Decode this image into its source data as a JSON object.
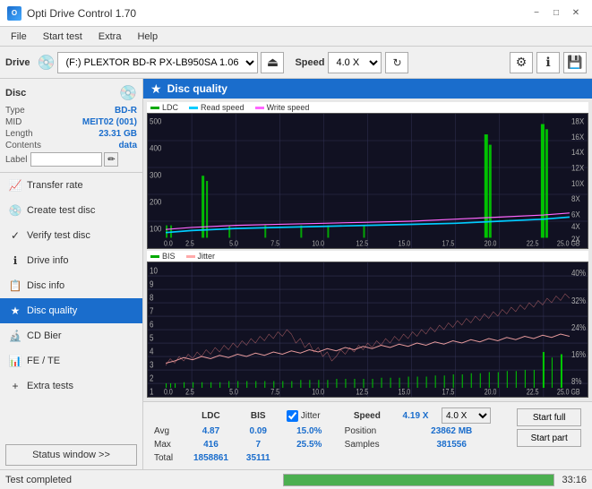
{
  "titlebar": {
    "title": "Opti Drive Control 1.70",
    "icon": "ODC"
  },
  "menubar": {
    "items": [
      "File",
      "Start test",
      "Extra",
      "Help"
    ]
  },
  "toolbar": {
    "drive_label": "Drive",
    "drive_value": "(F:) PLEXTOR BD-R  PX-LB950SA 1.06",
    "speed_label": "Speed",
    "speed_value": "4.0 X"
  },
  "disc": {
    "label": "Disc",
    "type_label": "Type",
    "type_value": "BD-R",
    "mid_label": "MID",
    "mid_value": "MEIT02 (001)",
    "length_label": "Length",
    "length_value": "23.31 GB",
    "contents_label": "Contents",
    "contents_value": "data",
    "label_label": "Label",
    "label_value": ""
  },
  "nav": {
    "items": [
      {
        "id": "transfer-rate",
        "label": "Transfer rate",
        "icon": "📈"
      },
      {
        "id": "create-test-disc",
        "label": "Create test disc",
        "icon": "💿"
      },
      {
        "id": "verify-test-disc",
        "label": "Verify test disc",
        "icon": "✓"
      },
      {
        "id": "drive-info",
        "label": "Drive info",
        "icon": "ℹ"
      },
      {
        "id": "disc-info",
        "label": "Disc info",
        "icon": "📋"
      },
      {
        "id": "disc-quality",
        "label": "Disc quality",
        "icon": "★",
        "active": true
      },
      {
        "id": "cd-bier",
        "label": "CD Bier",
        "icon": "🔬"
      },
      {
        "id": "fe-te",
        "label": "FE / TE",
        "icon": "📊"
      },
      {
        "id": "extra-tests",
        "label": "Extra tests",
        "icon": "+"
      }
    ]
  },
  "chart": {
    "title": "Disc quality",
    "legend_top": [
      {
        "label": "LDC",
        "color": "#00aa00"
      },
      {
        "label": "Read speed",
        "color": "#00ccff"
      },
      {
        "label": "Write speed",
        "color": "#ff66ff"
      }
    ],
    "legend_bottom": [
      {
        "label": "BIS",
        "color": "#00aa00"
      },
      {
        "label": "Jitter",
        "color": "#ffaaaa"
      }
    ],
    "top_y_left": [
      "500",
      "400",
      "300",
      "200",
      "100",
      "0"
    ],
    "top_y_right": [
      "18X",
      "16X",
      "14X",
      "12X",
      "10X",
      "8X",
      "6X",
      "4X",
      "2X"
    ],
    "bottom_y_left": [
      "10",
      "9",
      "8",
      "7",
      "6",
      "5",
      "4",
      "3",
      "2",
      "1"
    ],
    "bottom_y_right": [
      "40%",
      "32%",
      "24%",
      "16%",
      "8%"
    ],
    "x_labels": [
      "0.0",
      "2.5",
      "5.0",
      "7.5",
      "10.0",
      "12.5",
      "15.0",
      "17.5",
      "20.0",
      "22.5",
      "25.0 GB"
    ]
  },
  "stats": {
    "col_ldc": "LDC",
    "col_bis": "BIS",
    "col_jitter": "Jitter",
    "col_speed": "Speed",
    "col_speed_val": "4.19 X",
    "col_speed_select": "4.0 X",
    "row_avg_label": "Avg",
    "row_avg_ldc": "4.87",
    "row_avg_bis": "0.09",
    "row_avg_jitter": "15.0%",
    "row_avg_position_label": "Position",
    "row_avg_position_val": "23862 MB",
    "row_max_label": "Max",
    "row_max_ldc": "416",
    "row_max_bis": "7",
    "row_max_jitter": "25.5%",
    "row_max_samples_label": "Samples",
    "row_max_samples_val": "381556",
    "row_total_label": "Total",
    "row_total_ldc": "1858861",
    "row_total_bis": "35111",
    "btn_start_full": "Start full",
    "btn_start_part": "Start part",
    "jitter_checkbox": "Jitter"
  },
  "statusbar": {
    "text": "Test completed",
    "progress": 100,
    "time": "33:16"
  }
}
